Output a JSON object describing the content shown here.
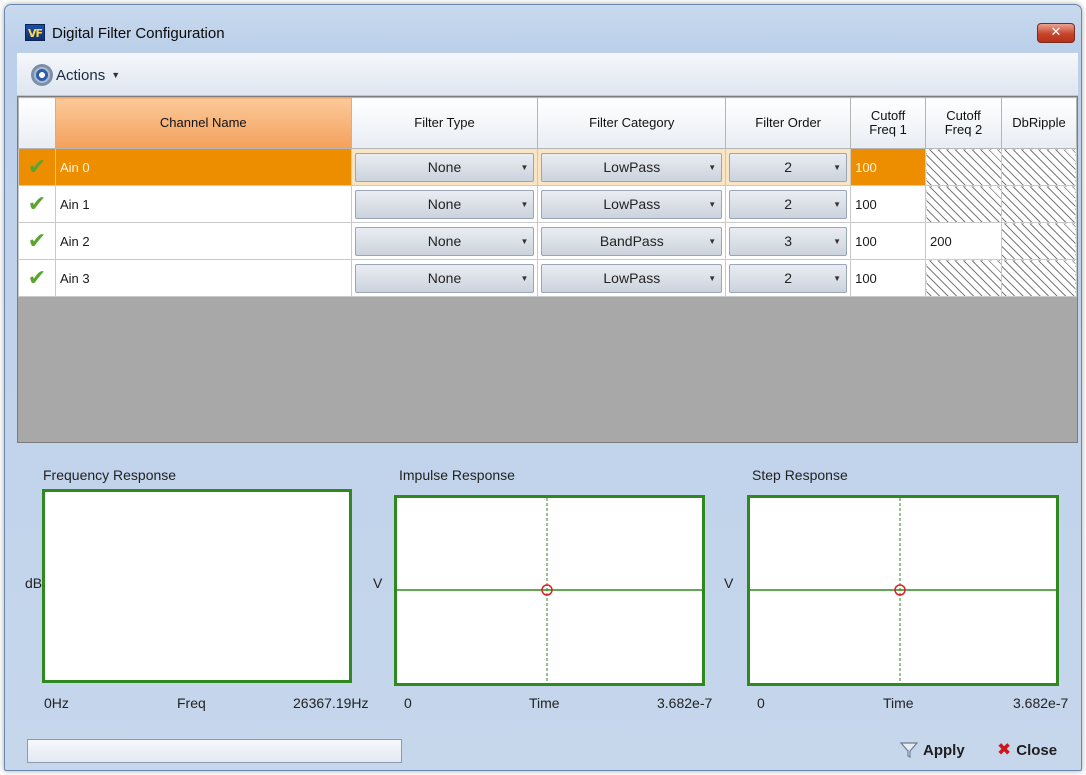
{
  "window": {
    "title": "Digital Filter Configuration",
    "app_icon": "VF",
    "close_glyph": "✕"
  },
  "toolbar": {
    "actions_label": "Actions",
    "actions_icon": "gear-icon"
  },
  "grid": {
    "columns": [
      {
        "key": "status",
        "label": ""
      },
      {
        "key": "channel_name",
        "label": "Channel Name"
      },
      {
        "key": "filter_type",
        "label": "Filter Type"
      },
      {
        "key": "filter_category",
        "label": "Filter Category"
      },
      {
        "key": "filter_order",
        "label": "Filter Order"
      },
      {
        "key": "cutoff1",
        "label1": "Cutoff",
        "label2": "Freq 1"
      },
      {
        "key": "cutoff2",
        "label1": "Cutoff",
        "label2": "Freq 2"
      },
      {
        "key": "dbripple",
        "label": "DbRipple"
      }
    ],
    "rows": [
      {
        "status": "✔",
        "channel_name": "Ain 0",
        "filter_type": "None",
        "filter_category": "LowPass",
        "filter_order": "2",
        "cutoff1": "100",
        "cutoff2": "",
        "dbripple": ""
      },
      {
        "status": "✔",
        "channel_name": "Ain 1",
        "filter_type": "None",
        "filter_category": "LowPass",
        "filter_order": "2",
        "cutoff1": "100",
        "cutoff2": "",
        "dbripple": ""
      },
      {
        "status": "✔",
        "channel_name": "Ain 2",
        "filter_type": "None",
        "filter_category": "BandPass",
        "filter_order": "3",
        "cutoff1": "100",
        "cutoff2": "200",
        "dbripple": ""
      },
      {
        "status": "✔",
        "channel_name": "Ain 3",
        "filter_type": "None",
        "filter_category": "LowPass",
        "filter_order": "2",
        "cutoff1": "100",
        "cutoff2": "",
        "dbripple": ""
      }
    ],
    "selected_row": 0
  },
  "charts": {
    "frequency": {
      "title": "Frequency Response",
      "ylabel": "dB",
      "x_min": "0Hz",
      "xlabel": "Freq",
      "x_max": "26367.19Hz"
    },
    "impulse": {
      "title": "Impulse Response",
      "ylabel": "V",
      "x_min": "0",
      "xlabel": "Time",
      "x_max": "3.682e-7"
    },
    "step": {
      "title": "Step Response",
      "ylabel": "V",
      "x_min": "0",
      "xlabel": "Time",
      "x_max": "3.682e-7"
    }
  },
  "footer": {
    "status_text": "",
    "apply_label": "Apply",
    "close_label": "Close"
  },
  "colors": {
    "selection": "#ed8e00",
    "chart_border": "#2e8a1f",
    "crosshair": "#2e8a1f",
    "marker": "#e02020",
    "check": "#5aa531"
  }
}
